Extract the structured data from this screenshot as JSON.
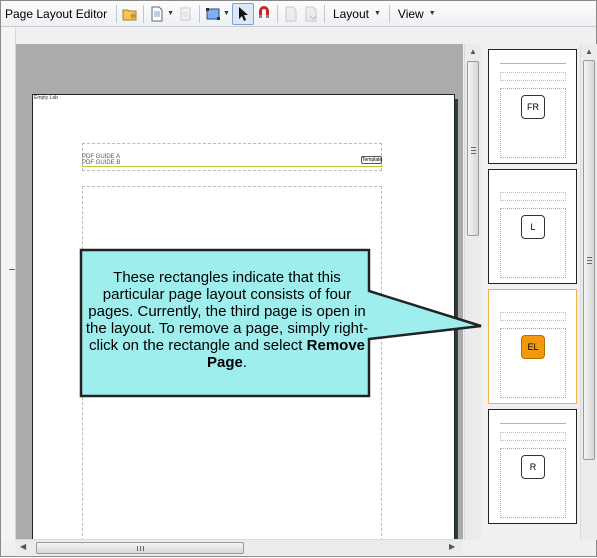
{
  "toolbar": {
    "title": "Page Layout Editor",
    "layout_menu": "Layout",
    "view_menu": "View"
  },
  "page": {
    "tag": "Empty Lab",
    "header_line1": "PDF GUIDE A",
    "header_line2": "PDF GUIDE B",
    "header_chip": "Template"
  },
  "thumbnails": [
    {
      "label": "FR",
      "selected": false
    },
    {
      "label": "L",
      "selected": false
    },
    {
      "label": "EL",
      "selected": true
    },
    {
      "label": "R",
      "selected": false
    }
  ],
  "callout": {
    "text": "These rectangles indicate that this particular page layout consists of four pages. Currently, the third page is open in the layout. To remove a page, simply right-click on the rectangle and select",
    "bold": "Remove Page",
    "end": "."
  },
  "colors": {
    "callout_fill": "#9eeeee",
    "selected_border": "#f0b44a",
    "selected_badge": "#f29a0f"
  }
}
